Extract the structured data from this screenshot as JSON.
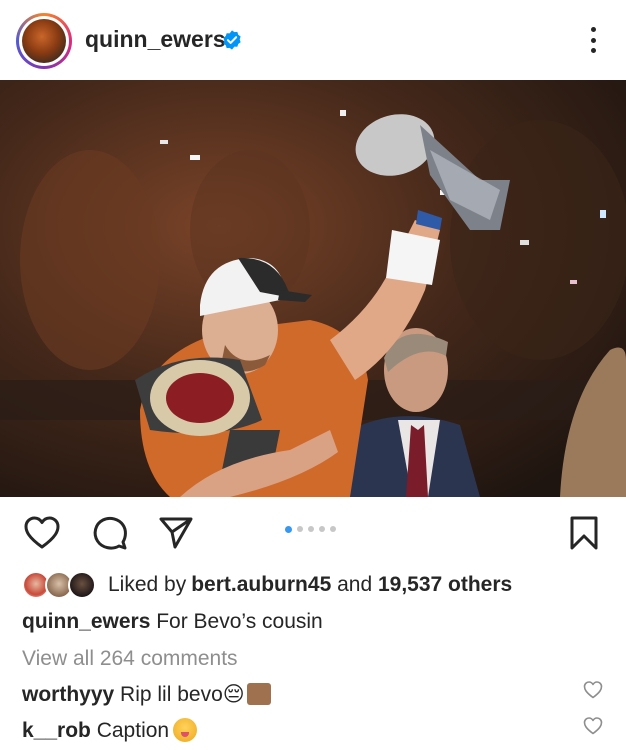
{
  "post": {
    "username": "quinn_ewers",
    "verified": true,
    "photo_alt_icon": "post-photo",
    "carousel": {
      "count": 5,
      "active_index": 0
    }
  },
  "likes": {
    "prefix": "Liked by ",
    "user": "bert.auburn45",
    "middle": " and ",
    "others": "19,537 others"
  },
  "caption": {
    "username": "quinn_ewers",
    "text": " For Bevo’s cousin"
  },
  "view_comments": "View all 264 comments",
  "comments": [
    {
      "username": "worthyyy",
      "text": " Rip lil bevo😔"
    },
    {
      "username": "k__rob",
      "text": " Caption"
    }
  ],
  "icons": {
    "like": "heart-icon",
    "comment": "comment-icon",
    "share": "send-icon",
    "save": "bookmark-icon",
    "more": "more-icon",
    "verified": "verified-badge-icon"
  },
  "colors": {
    "accent": "#3897f0",
    "verified": "#0095f6",
    "text": "#262626",
    "muted": "#8e8e8e"
  }
}
